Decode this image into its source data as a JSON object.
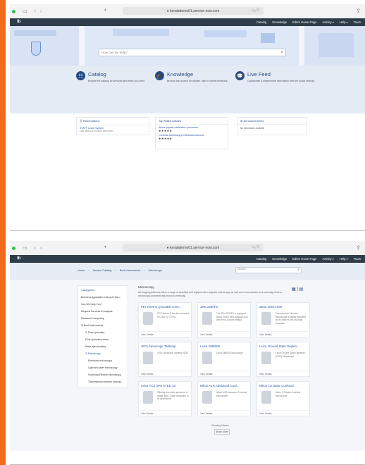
{
  "screen1": {
    "browser": {
      "url": "● keralademo01.service-now.com",
      "extra": "৩ৡ ©"
    },
    "navbar": {
      "logo": "ib",
      "items": [
        "Catalog",
        "Knowledge",
        "Editor Home Page",
        "Activity ▾",
        "Help ▾",
        "Tours"
      ]
    },
    "hero": {
      "search_placeholder": "How can we help?"
    },
    "band": [
      {
        "icon": "☷",
        "title": "Catalog",
        "desc": "Browse the catalog for services and items you need"
      },
      {
        "icon": "🎓",
        "title": "Knowledge",
        "desc": "Browse and search for articles, rate or submit feedback"
      },
      {
        "icon": "💬",
        "title": "Live Feed",
        "desc": "Collaborate & disseminate information with the social network"
      }
    ],
    "widgets": [
      {
        "head": "Ⓢ Reservations",
        "line": "STAFF Lead: System",
        "sub": "Last days lorem ipsum dolor amet"
      },
      {
        "head": "Top Rated Articles",
        "line": "Active pipette calibration procedure",
        "stars": "★★★★★",
        "line2": "Confocal Microscopy Individual sessions",
        "stars2": "★★★★★"
      },
      {
        "head": "☰ Announcements",
        "line": "No information available"
      }
    ]
  },
  "screen2": {
    "browser": {
      "url": "● keralademo01.service-now.com",
      "extra": "৩ৡ ©"
    },
    "navbar": {
      "logo": "ib",
      "items": [
        "Catalog",
        "Knowledge",
        "Editor Home Page",
        "Activity ▾",
        "Help ▾",
        "Tours"
      ]
    },
    "breadcrumbs": [
      "Home",
      "›",
      "Service Catalog",
      "›",
      "Book Instruments",
      "›",
      "Microscopy"
    ],
    "search_placeholder": "Search",
    "sidebar": {
      "head": "Categories",
      "items": [
        {
          "label": "Business Application Lifecycle Man...",
          "level": 0
        },
        {
          "label": "Can We Help You?",
          "level": 0
        },
        {
          "label": "Request Services & Analysis",
          "level": 0
        },
        {
          "label": "Research Computing",
          "level": 0
        },
        {
          "label": "⊟ Book Instruments",
          "level": 0
        },
        {
          "label": "⊡ Flow cytometry",
          "level": 1
        },
        {
          "label": "Flow cytometry sorter",
          "level": 1
        },
        {
          "label": "Mass spectrometry",
          "level": 1
        },
        {
          "label": "⊟ Microscopy",
          "level": 1,
          "active": true
        },
        {
          "label": "Electronic microscopy",
          "level": 2
        },
        {
          "label": "Light and laser microscopy",
          "level": 2
        },
        {
          "label": "Scanning Electron Microscopy",
          "level": 2
        },
        {
          "label": "Transmission electron microsc...",
          "level": 2
        }
      ]
    },
    "main": {
      "title": "Microscopy",
      "desc": "All imaging platforms offers a range of widefield and equipments in physics microscopy, as well as in transmission and scanning electron microscopy (conventional and cryo methods)",
      "toggle": "▦ | ▤"
    },
    "products": [
      {
        "title": "FEI Thermo Q Double corre...",
        "desc": "FEI Thermo Q Double corrected FEI 300 kV Q FEG",
        "foot": "View Details"
      },
      {
        "title": "JEM 2200FS",
        "desc": "The JEM 2200FS is equipped with a 200kV field emission gun and the in-column omega",
        "foot": "View Details"
      },
      {
        "title": "JEOL JEM-1400",
        "desc": "Transmission Electron Microscope is widely accepted for its ease of use and high resolution",
        "foot": "View Details"
      },
      {
        "title": "JEOL Neoscope Tabletop",
        "desc": "JEOL Neoscope Tabletop SEM",
        "foot": "View Details"
      },
      {
        "title": "Leica DM6000",
        "desc": "Leica DM6000 Microscope",
        "foot": "View Details"
      },
      {
        "title": "Leica Ground State Depleti...",
        "desc": "Leica Ground State Depletion (GSD) Microscope",
        "foot": "View Details"
      },
      {
        "title": "Leica TCS SP8 STED 3X",
        "desc": "Offering the whole spectrum of visible light - super resolution in all dimensions",
        "foot": "View Details"
      },
      {
        "title": "Nikon A1R Advanced Conf...",
        "desc": "Nikon A1R Advanced Confocal Microscope",
        "foot": "View Details"
      },
      {
        "title": "Nikon C2 Basic Confocal",
        "desc": "Nikon C2 Basic Confocal Microscope",
        "foot": "View Details"
      }
    ],
    "showing": "Showing 9 items",
    "show_more": "Show More"
  }
}
